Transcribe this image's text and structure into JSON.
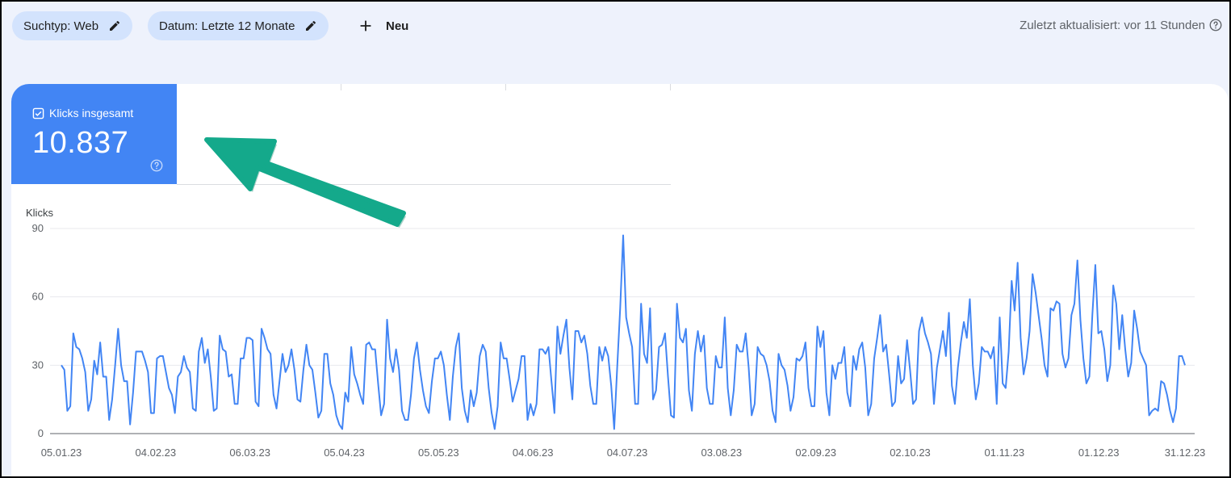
{
  "filters": {
    "search_type": "Suchtyp: Web",
    "date": "Datum: Letzte 12 Monate",
    "new_label": "Neu"
  },
  "status": {
    "updated_text": "Zuletzt aktualisiert: vor 11 Stunden"
  },
  "metric_card": {
    "label": "Klicks insgesamt",
    "value": "10.837",
    "checked": true
  },
  "colors": {
    "accent": "#4285f4",
    "arrow": "#14a98b",
    "chip": "#d3e3fd"
  },
  "icons": [
    "pencil-icon",
    "plus-icon",
    "help-circle-icon",
    "checkbox-icon",
    "arrow-annotation"
  ],
  "chart_data": {
    "type": "line",
    "ylabel": "Klicks",
    "ylim": [
      0,
      90
    ],
    "yticks": [
      0,
      30,
      60,
      90
    ],
    "x_ticks": [
      "05.01.23",
      "04.02.23",
      "06.03.23",
      "05.04.23",
      "05.05.23",
      "04.06.23",
      "04.07.23",
      "03.08.23",
      "02.09.23",
      "02.10.23",
      "01.11.23",
      "01.12.23",
      "31.12.23"
    ],
    "x_range": [
      "05.01.23",
      "31.12.23"
    ],
    "grid": true,
    "series": [
      {
        "color": "#4285f4",
        "values": [
          30,
          28,
          10,
          12,
          44,
          38,
          37,
          33,
          27,
          10,
          15,
          32,
          26,
          40,
          25,
          25,
          6,
          15,
          30,
          46,
          30,
          23,
          23,
          4,
          18,
          36,
          36,
          36,
          32,
          27,
          9,
          9,
          33,
          34,
          34,
          27,
          20,
          17,
          9,
          25,
          27,
          34,
          29,
          27,
          11,
          10,
          36,
          42,
          31,
          37,
          25,
          10,
          11,
          43,
          37,
          36,
          25,
          26,
          13,
          13,
          33,
          33,
          42,
          42,
          41,
          14,
          12,
          46,
          42,
          37,
          35,
          17,
          11,
          23,
          35,
          27,
          30,
          37,
          28,
          15,
          14,
          28,
          39,
          30,
          28,
          18,
          7,
          10,
          35,
          35,
          22,
          17,
          8,
          4,
          2,
          18,
          14,
          38,
          26,
          22,
          17,
          13,
          39,
          40,
          37,
          37,
          22,
          8,
          13,
          50,
          33,
          27,
          37,
          28,
          10,
          6,
          6,
          17,
          33,
          40,
          28,
          19,
          12,
          9,
          23,
          33,
          33,
          36,
          30,
          17,
          6,
          25,
          38,
          44,
          20,
          10,
          5,
          19,
          12,
          18,
          34,
          39,
          36,
          20,
          9,
          2,
          12,
          40,
          33,
          33,
          24,
          14,
          19,
          24,
          34,
          34,
          6,
          13,
          8,
          13,
          37,
          37,
          35,
          38,
          23,
          9,
          47,
          35,
          43,
          50,
          29,
          15,
          45,
          45,
          40,
          43,
          35,
          21,
          13,
          13,
          38,
          32,
          38,
          34,
          21,
          2,
          29,
          55,
          87,
          51,
          44,
          38,
          13,
          13,
          57,
          35,
          31,
          55,
          15,
          19,
          38,
          39,
          44,
          25,
          8,
          7,
          57,
          42,
          40,
          46,
          19,
          10,
          35,
          45,
          36,
          43,
          20,
          13,
          13,
          34,
          29,
          29,
          51,
          20,
          8,
          19,
          39,
          36,
          36,
          44,
          29,
          8,
          13,
          38,
          35,
          34,
          30,
          23,
          10,
          5,
          35,
          30,
          28,
          21,
          10,
          16,
          33,
          32,
          34,
          40,
          20,
          12,
          12,
          47,
          38,
          45,
          18,
          8,
          30,
          24,
          31,
          31,
          38,
          18,
          12,
          34,
          28,
          37,
          40,
          29,
          8,
          13,
          33,
          42,
          52,
          36,
          39,
          26,
          12,
          14,
          34,
          22,
          24,
          41,
          28,
          13,
          15,
          45,
          51,
          44,
          40,
          35,
          13,
          29,
          37,
          45,
          34,
          53,
          21,
          13,
          29,
          40,
          49,
          42,
          59,
          30,
          15,
          22,
          38,
          36,
          36,
          33,
          38,
          13,
          51,
          22,
          20,
          36,
          67,
          54,
          75,
          42,
          26,
          33,
          45,
          70,
          62,
          52,
          42,
          30,
          25,
          55,
          54,
          58,
          57,
          35,
          29,
          33,
          52,
          57,
          76,
          50,
          33,
          22,
          25,
          52,
          74,
          44,
          45,
          37,
          23,
          30,
          65,
          57,
          37,
          52,
          37,
          25,
          31,
          54,
          46,
          36,
          33,
          30,
          8,
          10,
          11,
          10,
          23,
          22,
          17,
          10,
          5,
          11,
          34,
          34,
          30
        ]
      }
    ]
  }
}
